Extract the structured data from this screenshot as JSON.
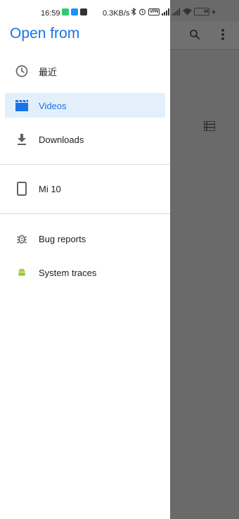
{
  "status_bar": {
    "time": "16:59",
    "network_speed": "0.3KB/s",
    "vpn_label": "VPN",
    "battery_level": "66",
    "app_icons": [
      "green-app-icon",
      "blue-cloud-icon",
      "v-app-icon"
    ],
    "colors": {
      "green_app": "#2ecc71",
      "blue_cloud": "#1e90ff",
      "v_app": "#333333"
    }
  },
  "drawer": {
    "title": "Open from",
    "sections": [
      {
        "items": [
          {
            "label": "最近",
            "icon": "clock-icon",
            "selected": false
          },
          {
            "label": "Videos",
            "icon": "videos-icon",
            "selected": true
          },
          {
            "label": "Downloads",
            "icon": "download-icon",
            "selected": false
          }
        ]
      },
      {
        "items": [
          {
            "label": "Mi 10",
            "icon": "phone-icon",
            "selected": false
          }
        ]
      },
      {
        "items": [
          {
            "label": "Bug reports",
            "icon": "bug-icon",
            "selected": false
          },
          {
            "label": "System traces",
            "icon": "android-icon",
            "selected": false
          }
        ]
      }
    ],
    "colors": {
      "accent": "#1a73e8",
      "selected_bg": "#e3f0fc",
      "android": "#9acd32"
    }
  },
  "background_app": {
    "toolbar_icons": [
      "search-icon",
      "more-vert-icon"
    ],
    "content_icon": "list-view-icon",
    "scrim_color": "#6a6a6a"
  }
}
